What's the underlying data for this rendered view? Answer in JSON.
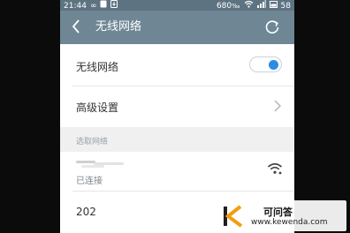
{
  "status_bar": {
    "time": "21:44",
    "loop_glyph": "∞",
    "speed": "680",
    "speed_unit": "‰",
    "battery": "58"
  },
  "header": {
    "title": "无线网络"
  },
  "wifi_toggle": {
    "label": "无线网络",
    "on": true
  },
  "advanced": {
    "label": "高级设置"
  },
  "networks_section": {
    "label": "选取网络",
    "connected_network": {
      "ssid_visible": "Sanjo",
      "status": "已连接"
    },
    "other_network": {
      "ssid": "202"
    }
  },
  "watermark": {
    "title": "可问答",
    "url": "www.kewenda.com",
    "logo_letter": "K"
  },
  "colors": {
    "status_bar": "#5e7381",
    "title_bar": "#6f8795",
    "accent": "#2a8de0",
    "section_bg": "#f0f0f0"
  }
}
